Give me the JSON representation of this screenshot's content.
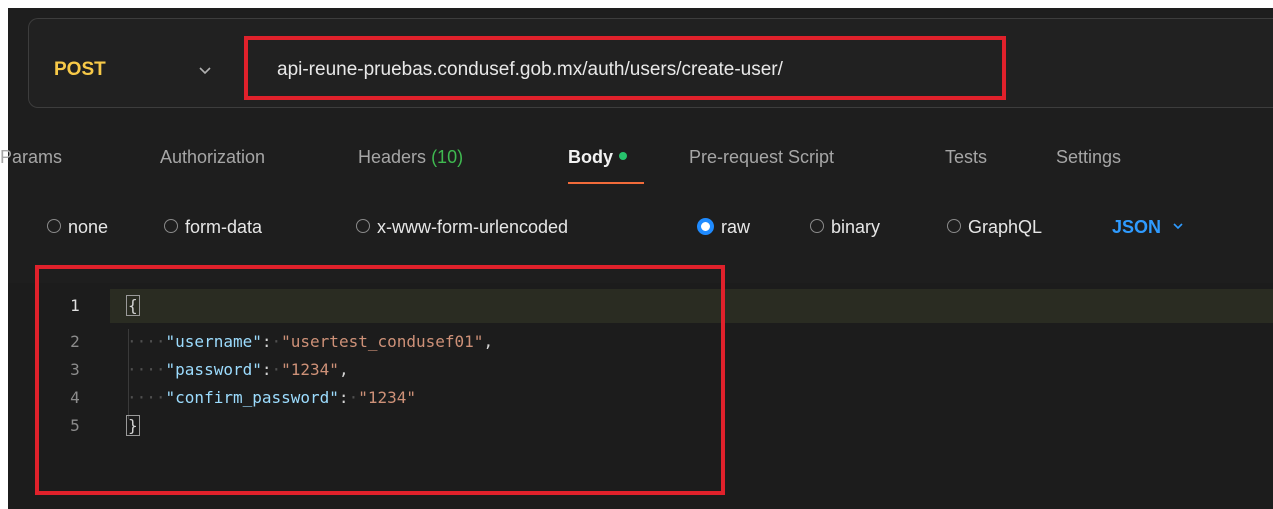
{
  "request": {
    "method": "POST",
    "url": "api-reune-pruebas.condusef.gob.mx/auth/users/create-user/"
  },
  "tabs": [
    {
      "label": "Params"
    },
    {
      "label": "Authorization"
    },
    {
      "label": "Headers",
      "count": "(10)"
    },
    {
      "label": "Body",
      "active": true
    },
    {
      "label": "Pre-request Script"
    },
    {
      "label": "Tests"
    },
    {
      "label": "Settings"
    }
  ],
  "body_types": [
    {
      "label": "none",
      "selected": false
    },
    {
      "label": "form-data",
      "selected": false
    },
    {
      "label": "x-www-form-urlencoded",
      "selected": false
    },
    {
      "label": "raw",
      "selected": true
    },
    {
      "label": "binary",
      "selected": false
    },
    {
      "label": "GraphQL",
      "selected": false
    }
  ],
  "format": "JSON",
  "editor": {
    "line_numbers": [
      "1",
      "2",
      "3",
      "4",
      "5"
    ],
    "open_brace": "{",
    "close_brace": "}",
    "fields": [
      {
        "key": "\"username\"",
        "value": "\"usertest_condusef01\"",
        "trail": ","
      },
      {
        "key": "\"password\"",
        "value": "\"1234\"",
        "trail": ","
      },
      {
        "key": "\"confirm_password\"",
        "value": "\"1234\"",
        "trail": ""
      }
    ]
  },
  "colors": {
    "method": "#f7c948",
    "highlight_box": "#e0212b",
    "json_key": "#9cdcfe",
    "json_string": "#ce9178",
    "active_accent": "#f26b3a",
    "selected_radio": "#1f8bff"
  },
  "icons": {
    "method_dropdown": "chevron-down-icon",
    "format_dropdown": "chevron-down-icon",
    "body_dot": "status-dot-icon"
  }
}
